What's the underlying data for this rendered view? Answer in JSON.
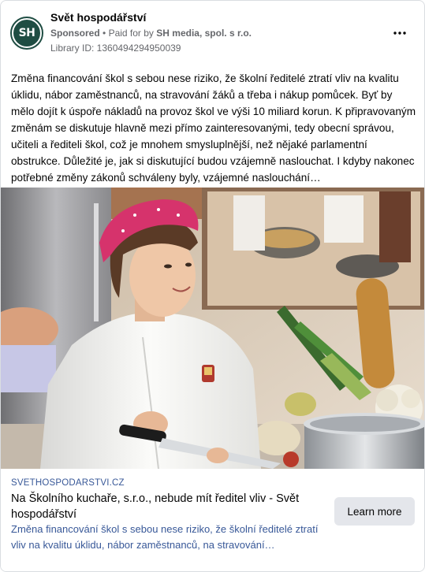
{
  "header": {
    "avatar_initials": "SH",
    "page_name": "Svět hospodářství",
    "sponsored_label": "Sponsored",
    "separator": "•",
    "paid_for_prefix": "Paid for by",
    "advertiser": "SH media, spol. s r.o.",
    "library_id": "Library ID: 1360494294950039",
    "more_icon": "more-horizontal-icon"
  },
  "body": {
    "text": "Změna financování škol s sebou nese riziko, že školní ředitelé ztratí vliv na kvalitu úklidu, nábor zaměstnanců, na stravování žáků a třeba i nákup pomůcek. Byť by mělo dojít k úspoře nákladů na provoz škol ve výši 10 miliard korun. K připravovaným změnám se diskutuje hlavně mezi přímo zainteresovanými, tedy obecní správou, učiteli a řediteli škol, což je mnohem smysluplnější, než nějaké parlamentní obstrukce. Důležité je, jak si diskutující budou vzájemně naslouchat. I kdyby nakonec potřebné změny zákonů schváleny byly, vzájemné naslouchání…"
  },
  "link": {
    "domain": "SVETHOSPODARSTVI.CZ",
    "title": "Na Školního kuchaře, s.r.o., nebude mít ředitel vliv - Svět hospodářství",
    "description": "Změna financování škol s sebou nese riziko, že školní ředitelé ztratí vliv na kvalitu úklidu, nábor zaměstnanců, na stravování…",
    "cta_label": "Learn more"
  },
  "colors": {
    "brand_green": "#1f4d43",
    "link_blue": "#385898",
    "muted_gray": "#65676b",
    "button_gray": "#e4e6eb"
  }
}
